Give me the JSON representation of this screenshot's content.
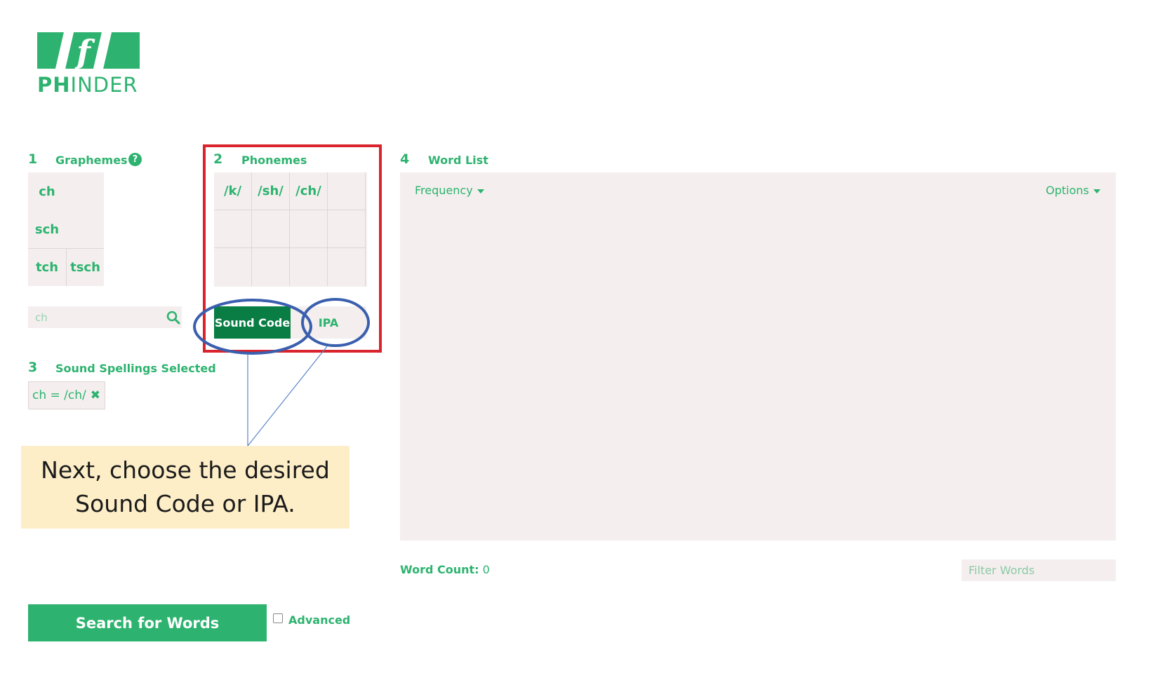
{
  "logo": {
    "brand_bold": "PH",
    "brand_rest": "INDER",
    "mark_text": "/f/"
  },
  "graphemes": {
    "number": "1",
    "title": "Graphemes",
    "help_icon": "question-circle-icon",
    "cells": [
      {
        "label": "ch"
      },
      {
        "label": "sch"
      },
      {
        "label": "tch"
      },
      {
        "label": "tsch"
      }
    ],
    "search": {
      "value": "",
      "placeholder": "ch",
      "icon": "search-icon"
    }
  },
  "phonemes": {
    "number": "2",
    "title": "Phonemes",
    "cells": [
      "/k/",
      "/sh/",
      "/ch/"
    ],
    "sound_code_label": "Sound Code",
    "ipa_label": "IPA"
  },
  "selected": {
    "number": "3",
    "title": "Sound Spellings Selected",
    "chips": [
      {
        "label": "ch = /ch/",
        "remove_icon": "close-icon"
      }
    ]
  },
  "callout": {
    "line1": "Next, choose the desired",
    "line2": "Sound Code or IPA."
  },
  "word_list": {
    "number": "4",
    "title": "Word List",
    "sort_label": "Frequency",
    "options_label": "Options",
    "count_label": "Word Count:",
    "count_value": "0",
    "filter_placeholder": "Filter Words"
  },
  "footer": {
    "search_button": "Search for Words",
    "advanced_label": "Advanced",
    "advanced_checked": false
  },
  "colors": {
    "brand_green": "#2db36f",
    "dark_green": "#0a7d44",
    "panel_bg": "#f4efee",
    "highlight_red": "#d9232d",
    "highlight_blue": "#3a5fae",
    "callout_bg": "#fdeec8"
  }
}
